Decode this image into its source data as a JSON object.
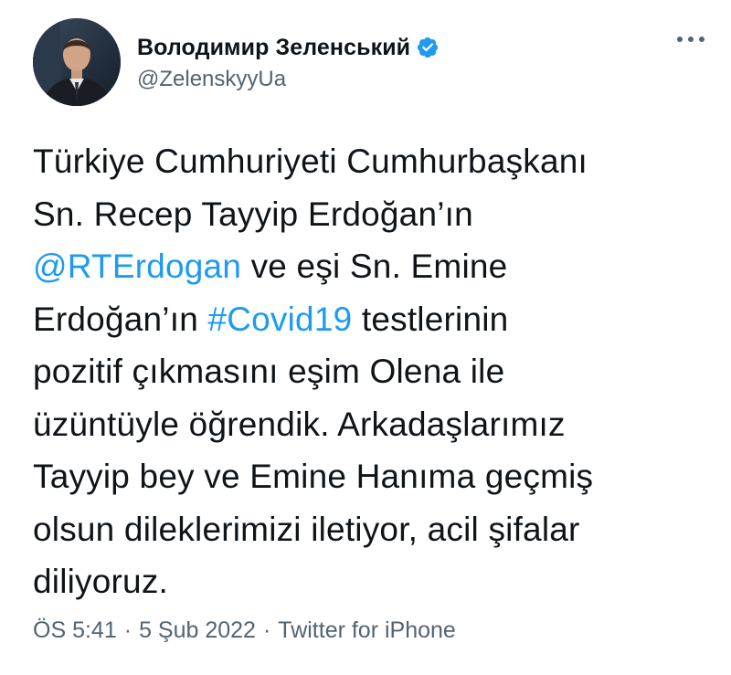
{
  "author": {
    "display_name": "Володимир Зеленський",
    "handle": "@ZelenskyyUa",
    "verified_icon": "verified-badge-icon",
    "avatar_icon": "profile-photo"
  },
  "menu": {
    "icon": "more-horizontal-icon"
  },
  "tweet": {
    "lines": [
      [
        {
          "text": "Türkiye Cumhuriyeti Cumhurbaşkanı",
          "link": false
        }
      ],
      [
        {
          "text": "Sn. Recep Tayyip Erdoğan’ın",
          "link": false
        }
      ],
      [
        {
          "text": "@RTErdogan",
          "link": true
        },
        {
          "text": " ve eşi Sn. Emine",
          "link": false
        }
      ],
      [
        {
          "text": "Erdoğan’ın ",
          "link": false
        },
        {
          "text": "#Covid19",
          "link": true
        },
        {
          "text": " testlerinin",
          "link": false
        }
      ],
      [
        {
          "text": "pozitif çıkmasını eşim Olena ile",
          "link": false
        }
      ],
      [
        {
          "text": "üzüntüyle öğrendik. Arkadaşlarımız",
          "link": false
        }
      ],
      [
        {
          "text": "Tayyip bey ve Emine Hanıma geçmiş",
          "link": false
        }
      ],
      [
        {
          "text": "olsun dileklerimizi iletiyor, acil şifalar",
          "link": false
        }
      ],
      [
        {
          "text": "diliyoruz.",
          "link": false
        }
      ]
    ]
  },
  "meta": {
    "time": "ÖS 5:41",
    "separator": "·",
    "date": "5 Şub 2022",
    "source": "Twitter for iPhone"
  },
  "colors": {
    "link": "#1d9bf0",
    "secondary_text": "#536471",
    "primary_text": "#0f1419",
    "verified": "#1d9bf0"
  }
}
